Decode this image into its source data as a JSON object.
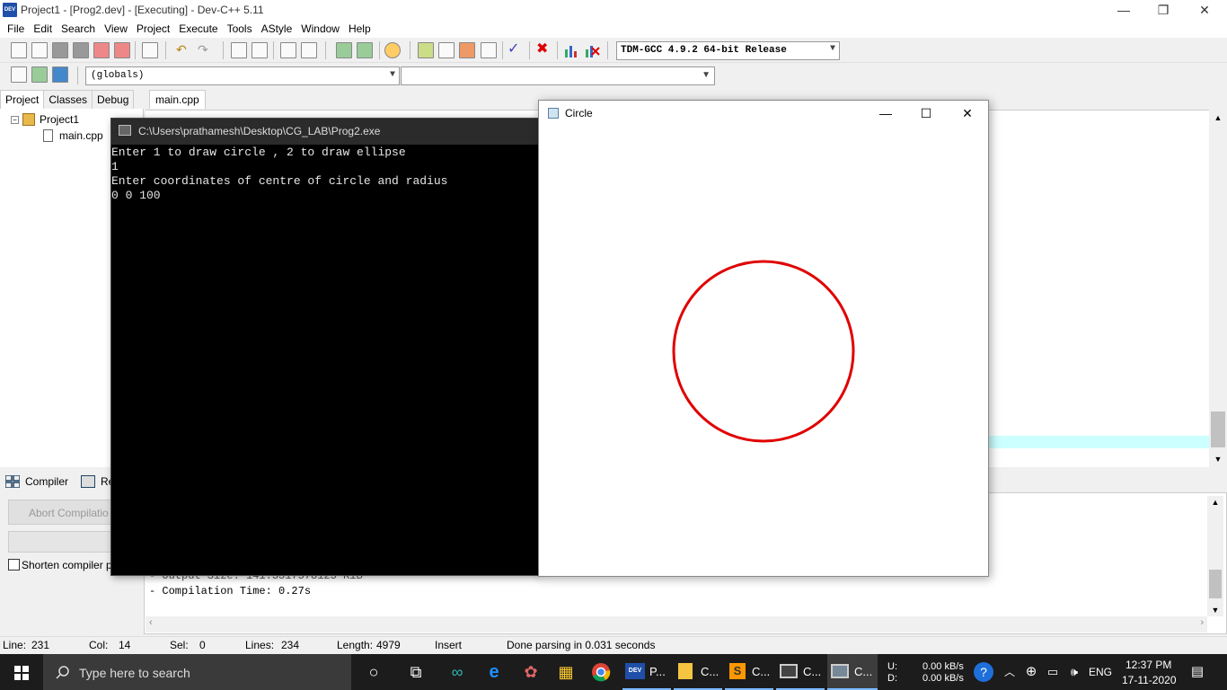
{
  "window": {
    "title": "Project1 - [Prog2.dev] - [Executing] - Dev-C++ 5.11",
    "minimize": "—",
    "restore": "❐",
    "close": "✕"
  },
  "menu": [
    "File",
    "Edit",
    "Search",
    "View",
    "Project",
    "Execute",
    "Tools",
    "AStyle",
    "Window",
    "Help"
  ],
  "toolbar": {
    "compiler": "TDM-GCC 4.9.2 64-bit Release",
    "scope": "(globals)"
  },
  "left_panel": {
    "tabs": [
      "Project",
      "Classes",
      "Debug"
    ],
    "project": "Project1",
    "file": "main.cpp"
  },
  "editor": {
    "tab": "main.cpp"
  },
  "bottom": {
    "tabs": [
      "Compiler",
      "Re"
    ],
    "abort": "Abort Compilatio",
    "shorten": "Shorten compiler p",
    "log": [
      "- Output Size: 141.3317578125 KiB",
      "- Compilation Time: 0.27s"
    ]
  },
  "status": {
    "line": "Line:",
    "line_val": "231",
    "col": "Col:",
    "col_val": "14",
    "sel": "Sel:",
    "sel_val": "0",
    "lines": "Lines:",
    "lines_val": "234",
    "length": "Length:",
    "length_val": "4979",
    "mode": "Insert",
    "message": "Done parsing in 0.031 seconds"
  },
  "console": {
    "title": "C:\\Users\\prathamesh\\Desktop\\CG_LAB\\Prog2.exe",
    "lines": [
      "Enter 1 to draw circle , 2 to draw ellipse",
      "1",
      "Enter coordinates of centre of circle and radius",
      "0 0 100"
    ]
  },
  "circle_window": {
    "title": "Circle",
    "circle_color": "#e00000"
  },
  "taskbar": {
    "search": "Type here to search",
    "items": [
      "P...",
      "C...",
      "C...",
      "C...",
      "C..."
    ],
    "net_u": "U:",
    "net_d": "D:",
    "net_up": "0.00 kB/s",
    "net_down": "0.00 kB/s",
    "lang": "ENG",
    "time": "12:37 PM",
    "date": "17-11-2020"
  }
}
